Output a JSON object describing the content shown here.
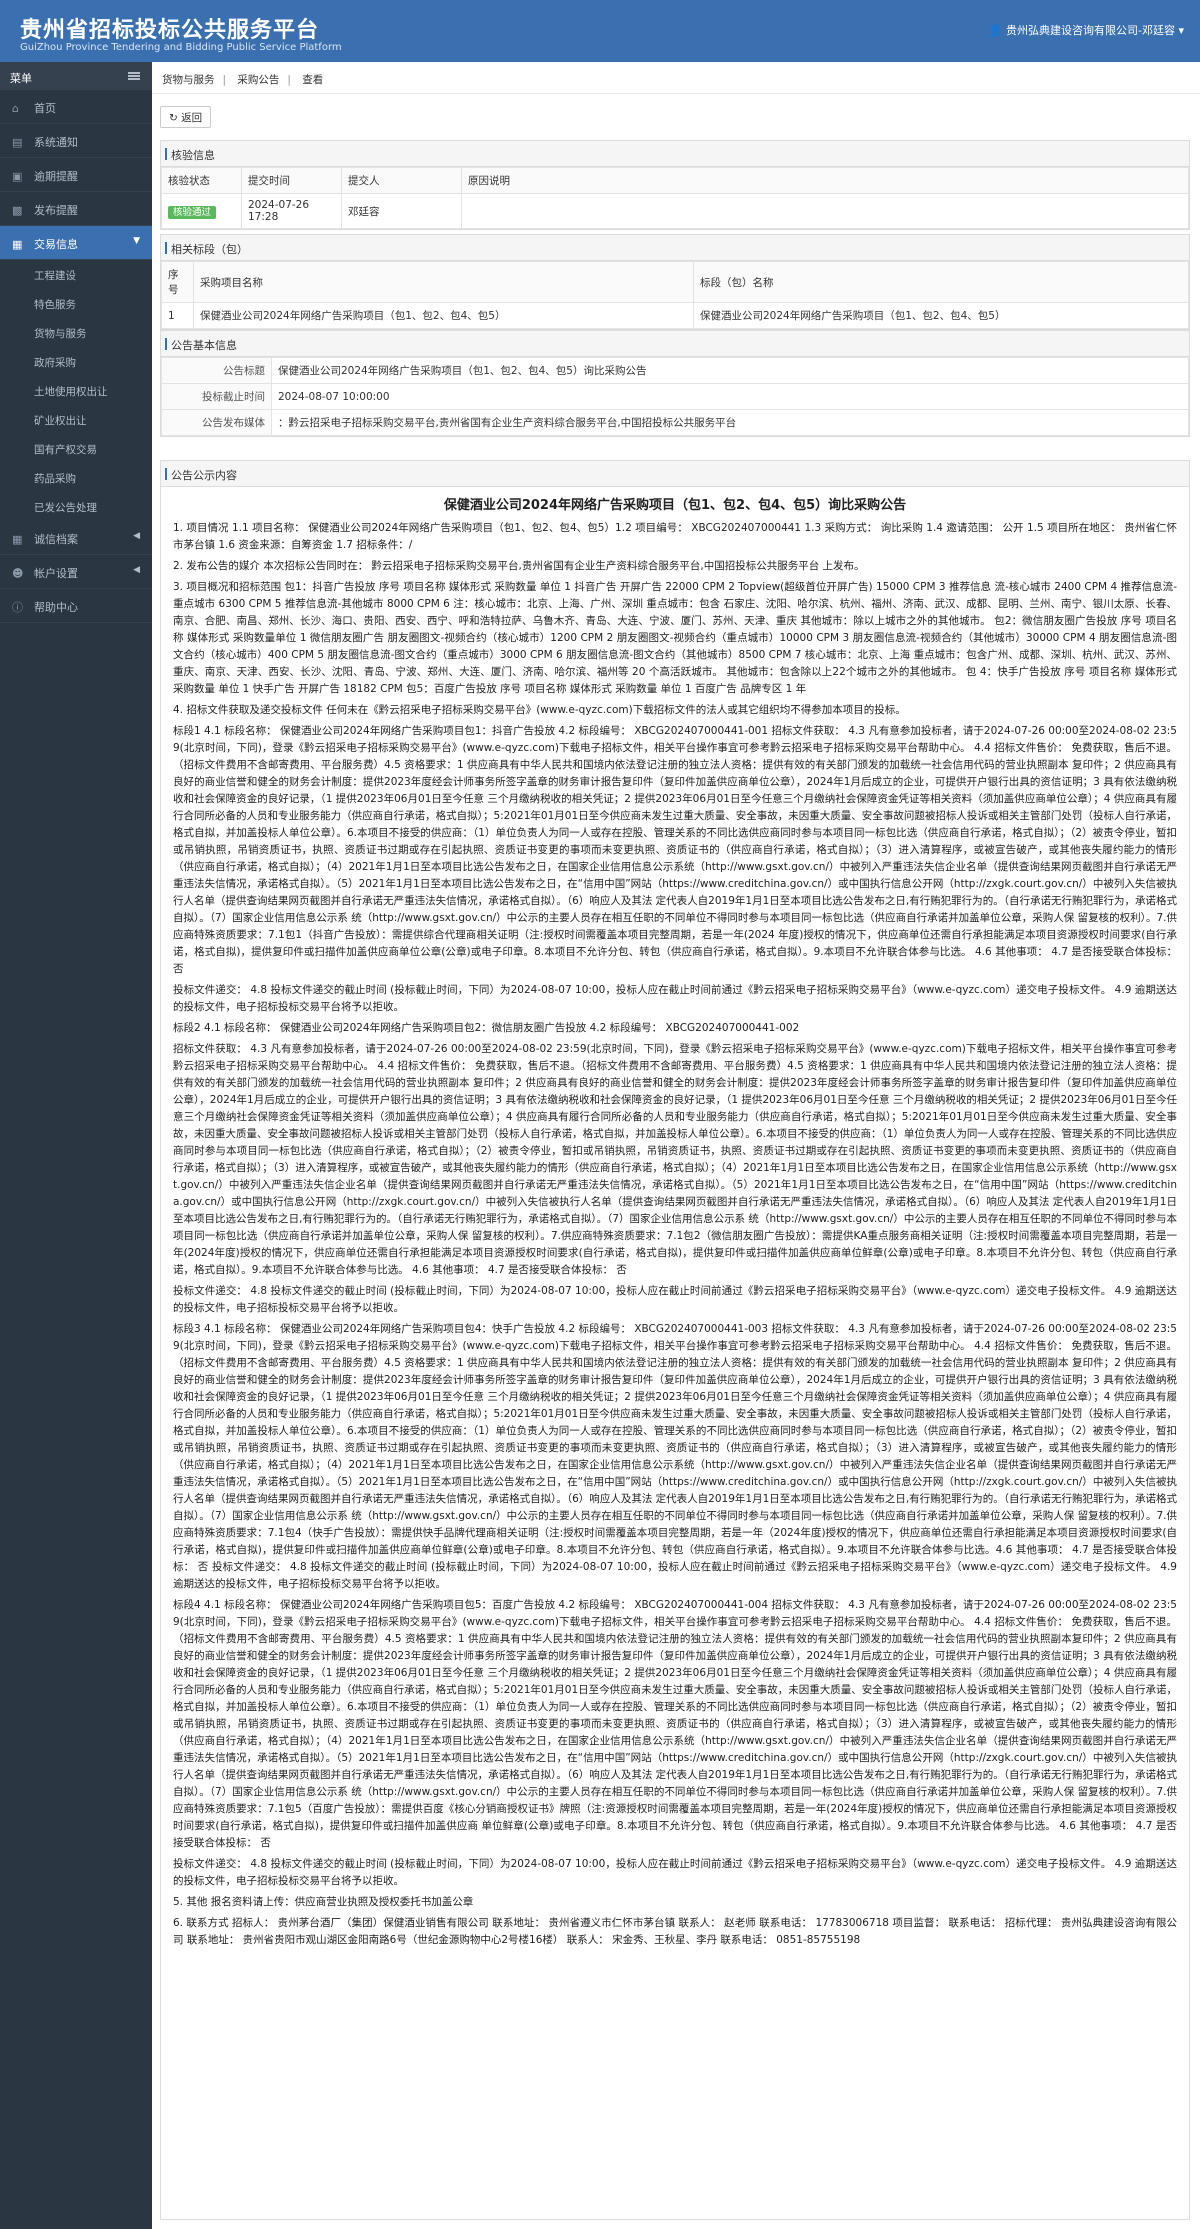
{
  "header": {
    "title_cn": "贵州省招标投标公共服务平台",
    "title_en": "GuiZhou Province Tendering and Bidding Public Service Platform",
    "user": "贵州弘典建设咨询有限公司-邓廷容"
  },
  "sidebar": {
    "menu_label": "菜单",
    "items": [
      {
        "label": "首页",
        "icon": "home-icon"
      },
      {
        "label": "系统通知",
        "icon": "notice-icon"
      },
      {
        "label": "逾期提醒",
        "icon": "alarm-icon"
      },
      {
        "label": "发布提醒",
        "icon": "publish-icon"
      },
      {
        "label": "交易信息",
        "icon": "trade-icon"
      }
    ],
    "sub_items": [
      "工程建设",
      "特色服务",
      "货物与服务",
      "政府采购",
      "土地使用权出让",
      "矿业权出让",
      "国有产权交易",
      "药品采购",
      "已发公告处理"
    ],
    "bottom_items": [
      {
        "label": "诚信档案",
        "icon": "archive-icon"
      },
      {
        "label": "帐户设置",
        "icon": "user-icon"
      },
      {
        "label": "帮助中心",
        "icon": "help-icon"
      }
    ]
  },
  "breadcrumb": [
    "货物与服务",
    "采购公告",
    "查看"
  ],
  "back_label": "返回",
  "review": {
    "title": "核验信息",
    "headers": [
      "核验状态",
      "提交时间",
      "提交人",
      "原因说明"
    ],
    "status": "核验通过",
    "time": "2024-07-26 17:28",
    "person": "邓廷容",
    "reason": ""
  },
  "sections": {
    "title": "相关标段（包）",
    "headers": [
      "序号",
      "采购项目名称",
      "标段（包）名称"
    ],
    "rows": [
      {
        "no": "1",
        "project": "保健酒业公司2024年网络广告采购项目（包1、包2、包4、包5）",
        "section": "保健酒业公司2024年网络广告采购项目（包1、包2、包4、包5）"
      }
    ]
  },
  "basic": {
    "title": "公告基本信息",
    "title_label": "公告标题",
    "title_value": "保健酒业公司2024年网络广告采购项目（包1、包2、包4、包5）询比采购公告",
    "deadline_label": "投标截止时间",
    "deadline_value": "2024-08-07 10:00:00",
    "media_label": "公告发布媒体",
    "media_value": "：黔云招采电子招标采购交易平台,贵州省国有企业生产资料综合服务平台,中国招投标公共服务平台"
  },
  "notice": {
    "panel_title": "公告公示内容",
    "title": "保健酒业公司2024年网络广告采购项目（包1、包2、包4、包5）询比采购公告",
    "paragraphs": [
      "1. 项目情况 1.1 项目名称： 保健酒业公司2024年网络广告采购项目（包1、包2、包4、包5）1.2 项目编号： XBCG202407000441 1.3 采购方式： 询比采购 1.4 邀请范围： 公开 1.5 项目所在地区： 贵州省仁怀市茅台镇 1.6 资金来源：自筹资金 1.7 招标条件：/",
      "2. 发布公告的媒介 本次招标公告同时在： 黔云招采电子招标采购交易平台,贵州省国有企业生产资料综合服务平台,中国招投标公共服务平台 上发布。",
      "3. 项目概况和招标范围 包1：抖音广告投放 序号 项目名称 媒体形式 采购数量 单位 1 抖音广告 开屏广告 22000 CPM 2 Topview(超级首位开屏广告) 15000 CPM 3 推荐信息 流-核心城市 2400 CPM 4 推荐信息流-重点城市 6300 CPM 5 推荐信息流-其他城市 8000 CPM 6 注：核心城市：北京、上海、广州、深圳 重点城市：包含 石家庄、沈阳、哈尔滨、杭州、福州、济南、武汉、成都、昆明、兰州、南宁、银川太原、长春、南京、合肥、南昌、郑州、长沙、海口、贵阳、西安、西宁、呼和浩特拉萨、乌鲁木齐、青岛、大连、宁波、厦门、苏州、天津、重庆 其他城市：除以上城市之外的其他城市。 包2：微信朋友圈广告投放 序号 项目名称 媒体形式 采购数量单位 1 微信朋友圈广告 朋友圈图文-视频合约（核心城市）1200 CPM 2 朋友圈图文-视频合约（重点城市）10000 CPM 3 朋友圈信息流-视频合约（其他城市）30000 CPM 4 朋友圈信息流-图文合约（核心城市）400 CPM 5 朋友圈信息流-图文合约（重点城市）3000 CPM 6 朋友圈信息流-图文合约（其他城市）8500 CPM 7 核心城市：北京、上海 重点城市：包含广州、成都、深圳、杭州、武汉、苏州、重庆、南京、天津、西安、长沙、沈阳、青岛、宁波、郑州、大连、厦门、济南、哈尔滨、福州等 20 个高活跃城市。 其他城市：包含除以上22个城市之外的其他城市。 包 4：快手广告投放 序号 项目名称 媒体形式 采购数量 单位 1 快手广告 开屏广告 18182 CPM 包5：百度广告投放 序号 项目名称 媒体形式 采购数量 单位 1 百度广告 品牌专区 1 年",
      "4. 招标文件获取及递交投标文件 任何未在《黔云招采电子招标采购交易平台》(www.e-qyzc.com)下载招标文件的法人或其它组织均不得参加本项目的投标。",
      "标段1 4.1 标段名称： 保健酒业公司2024年网络广告采购项目包1：抖音广告投放 4.2 标段编号： XBCG202407000441-001 招标文件获取： 4.3 凡有意参加投标者，请于2024-07-26 00:00至2024-08-02 23:59(北京时间，下同)，登录《黔云招采电子招标采购交易平台》(www.e-qyzc.com)下载电子招标文件，相关平台操作事宜可参考黔云招采电子招标采购交易平台帮助中心。 4.4 招标文件售价： 免费获取，售后不退。（招标文件费用不含邮寄费用、平台服务费）4.5 资格要求：1 供应商具有中华人民共和国境内依法登记注册的独立法人资格：提供有效的有关部门颁发的加载统一社会信用代码的营业执照副本 复印件；2 供应商具有良好的商业信誉和健全的财务会计制度：提供2023年度经会计师事务所签字盖章的财务审计报告复印件（复印件加盖供应商单位公章），2024年1月后成立的企业，可提供开户银行出具的资信证明；3 具有依法缴纳税收和社会保障资金的良好记录，（1 提供2023年06月01日至今任意 三个月缴纳税收的相关凭证；2 提供2023年06月01日至今任意三个月缴纳社会保障资金凭证等相关资料（须加盖供应商单位公章）；4 供应商具有履行合同所必备的人员和专业服务能力（供应商自行承诺，格式自拟）；5:2021年01月01日至今供应商未发生过重大质量、安全事故，未因重大质量、安全事故问题被招标人投诉或相关主管部门处罚（投标人自行承诺，格式自拟，并加盖投标人单位公章）。6.本项目不接受的供应商：（1）单位负责人为同一人或存在控股、管理关系的不同比选供应商同时参与本项目同一标包比选（供应商自行承诺，格式自拟）；（2）被责令停业，暂扣或吊销执照，吊销资质证书，执照、资质证书过期或存在引起执照、资质证书变更的事项而未变更执照、资质证书的（供应商自行承诺，格式自拟）；（3）进入清算程序，或被宣告破产，或其他丧失履约能力的情形（供应商自行承诺，格式自拟）；（4）2021年1月1日至本项目比选公告发布之日，在国家企业信用信息公示系统（http://www.gsxt.gov.cn/）中被列入严重违法失信企业名单（提供查询结果网页截图并自行承诺无严重违法失信情况，承诺格式自拟）。（5）2021年1月1日至本项目比选公告发布之日，在“信用中国”网站（https://www.creditchina.gov.cn/）或中国执行信息公开网（http://zxgk.court.gov.cn/）中被列入失信被执行人名单（提供查询结果网页截图并自行承诺无严重违法失信情况，承诺格式自拟）。（6）响应人及其法 定代表人自2019年1月1日至本项目比选公告发布之日,有行贿犯罪行为的。（自行承诺无行贿犯罪行为，承诺格式自拟）。（7）国家企业信用信息公示系 统（http://www.gsxt.gov.cn/）中公示的主要人员存在相互任职的不同单位不得同时参与本项目同一标包比选（供应商自行承诺并加盖单位公章，采购人保 留复核的权利）。7.供应商特殊资质要求：7.1包1（抖音广告投放）：需提供综合代理商相关证明（注:授权时间需覆盖本项目完整周期，若是一年(2024 年度)授权的情况下，供应商单位还需自行承担能满足本项目资源授权时间要求(自行承诺，格式自拟)，提供复印件或扫描件加盖供应商单位公章(公章)或电子印章。8.本项目不允许分包、转包（供应商自行承诺，格式自拟）。9.本项目不允许联合体参与比选。 4.6 其他事项： 4.7 是否接受联合体投标： 否",
      "投标文件递交： 4.8 投标文件递交的截止时间 (投标截止时间，下同）为2024-08-07 10:00，投标人应在截止时间前通过《黔云招采电子招标采购交易平台》（www.e-qyzc.com）递交电子投标文件。 4.9 逾期送达的投标文件，电子招标投标交易平台将予以拒收。",
      "标段2 4.1 标段名称： 保健酒业公司2024年网络广告采购项目包2：微信朋友圈广告投放 4.2 标段编号： XBCG202407000441-002",
      "招标文件获取： 4.3 凡有意参加投标者，请于2024-07-26 00:00至2024-08-02 23:59(北京时间，下同)，登录《黔云招采电子招标采购交易平台》(www.e-qyzc.com)下载电子招标文件，相关平台操作事宜可参考黔云招采电子招标采购交易平台帮助中心。 4.4 招标文件售价： 免费获取，售后不退。（招标文件费用不含邮寄费用、平台服务费）4.5 资格要求：1 供应商具有中华人民共和国境内依法登记注册的独立法人资格：提供有效的有关部门颁发的加载统一社会信用代码的营业执照副本 复印件；2 供应商具有良好的商业信誉和健全的财务会计制度：提供2023年度经会计师事务所签字盖章的财务审计报告复印件（复印件加盖供应商单位公章），2024年1月后成立的企业，可提供开户银行出具的资信证明；3 具有依法缴纳税收和社会保障资金的良好记录，（1 提供2023年06月01日至今任意 三个月缴纳税收的相关凭证；2 提供2023年06月01日至今任意三个月缴纳社会保障资金凭证等相关资料（须加盖供应商单位公章）；4 供应商具有履行合同所必备的人员和专业服务能力（供应商自行承诺，格式自拟）；5:2021年01月01日至今供应商未发生过重大质量、安全事故，未因重大质量、安全事故问题被招标人投诉或相关主管部门处罚（投标人自行承诺，格式自拟，并加盖投标人单位公章）。6.本项目不接受的供应商：（1）单位负责人为同一人或存在控股、管理关系的不同比选供应商同时参与本项目同一标包比选（供应商自行承诺，格式自拟）；（2）被责令停业，暂扣或吊销执照，吊销资质证书，执照、资质证书过期或存在引起执照、资质证书变更的事项而未变更执照、资质证书的（供应商自行承诺，格式自拟）；（3）进入清算程序，或被宣告破产，或其他丧失履约能力的情形（供应商自行承诺，格式自拟）；（4）2021年1月1日至本项目比选公告发布之日，在国家企业信用信息公示系统（http://www.gsxt.gov.cn/）中被列入严重违法失信企业名单（提供查询结果网页截图并自行承诺无严重违法失信情况，承诺格式自拟）。（5）2021年1月1日至本项目比选公告发布之日，在“信用中国”网站（https://www.creditchina.gov.cn/）或中国执行信息公开网（http://zxgk.court.gov.cn/）中被列入失信被执行人名单（提供查询结果网页截图并自行承诺无严重违法失信情况，承诺格式自拟）。（6）响应人及其法 定代表人自2019年1月1日至本项目比选公告发布之日,有行贿犯罪行为的。（自行承诺无行贿犯罪行为，承诺格式自拟）。（7）国家企业信用信息公示系 统（http://www.gsxt.gov.cn/）中公示的主要人员存在相互任职的不同单位不得同时参与本项目同一标包比选（供应商自行承诺并加盖单位公章，采购人保 留复核的权利）。7.供应商特殊资质要求：7.1包2（微信朋友圈广告投放）：需提供KA重点服务商相关证明（注:授权时间需覆盖本项目完整周期，若是一年(2024年度)授权的情况下，供应商单位还需自行承担能满足本项目资源授权时间要求(自行承诺，格式自拟)，提供复印件或扫描件加盖供应商单位鲜章(公章)或电子印章。8.本项目不允许分包、转包（供应商自行承诺，格式自拟）。9.本项目不允许联合体参与比选。 4.6 其他事项： 4.7 是否接受联合体投标： 否",
      "投标文件递交： 4.8 投标文件递交的截止时间 (投标截止时间，下同）为2024-08-07 10:00，投标人应在截止时间前通过《黔云招采电子招标采购交易平台》（www.e-qyzc.com）递交电子投标文件。 4.9 逾期送达的投标文件，电子招标投标交易平台将予以拒收。",
      "标段3 4.1 标段名称： 保健酒业公司2024年网络广告采购项目包4：快手广告投放 4.2 标段编号： XBCG202407000441-003 招标文件获取： 4.3 凡有意参加投标者，请于2024-07-26 00:00至2024-08-02 23:59(北京时间，下同)，登录《黔云招采电子招标采购交易平台》(www.e-qyzc.com)下载电子招标文件，相关平台操作事宜可参考黔云招采电子招标采购交易平台帮助中心。 4.4 招标文件售价： 免费获取，售后不退。（招标文件费用不含邮寄费用、平台服务费）4.5 资格要求：1 供应商具有中华人民共和国境内依法登记注册的独立法人资格：提供有效的有关部门颁发的加载统一社会信用代码的营业执照副本 复印件；2 供应商具有良好的商业信誉和健全的财务会计制度：提供2023年度经会计师事务所签字盖章的财务审计报告复印件（复印件加盖供应商单位公章），2024年1月后成立的企业，可提供开户银行出具的资信证明；3 具有依法缴纳税收和社会保障资金的良好记录，（1 提供2023年06月01日至今任意 三个月缴纳税收的相关凭证；2 提供2023年06月01日至今任意三个月缴纳社会保障资金凭证等相关资料（须加盖供应商单位公章）；4 供应商具有履行合同所必备的人员和专业服务能力（供应商自行承诺，格式自拟）；5:2021年01月01日至今供应商未发生过重大质量、安全事故，未因重大质量、安全事故问题被招标人投诉或相关主管部门处罚（投标人自行承诺，格式自拟，并加盖投标人单位公章）。6.本项目不接受的供应商：（1）单位负责人为同一人或存在控股、管理关系的不同比选供应商同时参与本项目同一标包比选（供应商自行承诺，格式自拟）；（2）被责令停业，暂扣或吊销执照，吊销资质证书，执照、资质证书过期或存在引起执照、资质证书变更的事项而未变更执照、资质证书的（供应商自行承诺，格式自拟）；（3）进入清算程序，或被宣告破产，或其他丧失履约能力的情形（供应商自行承诺，格式自拟）；（4）2021年1月1日至本项目比选公告发布之日，在国家企业信用信息公示系统（http://www.gsxt.gov.cn/）中被列入严重违法失信企业名单（提供查询结果网页截图并自行承诺无严重违法失信情况，承诺格式自拟）。（5）2021年1月1日至本项目比选公告发布之日，在“信用中国”网站（https://www.creditchina.gov.cn/）或中国执行信息公开网（http://zxgk.court.gov.cn/）中被列入失信被执行人名单（提供查询结果网页截图并自行承诺无严重违法失信情况，承诺格式自拟）。（6）响应人及其法 定代表人自2019年1月1日至本项目比选公告发布之日,有行贿犯罪行为的。（自行承诺无行贿犯罪行为，承诺格式自拟）。（7）国家企业信用信息公示系 统（http://www.gsxt.gov.cn/）中公示的主要人员存在相互任职的不同单位不得同时参与本项目同一标包比选（供应商自行承诺并加盖单位公章，采购人保 留复核的权利）。7.供应商特殊资质要求：7.1包4（快手广告投放）：需提供快手品牌代理商相关证明（注:授权时间需覆盖本项目完整周期，若是一年（2024年度)授权的情况下，供应商单位还需自行承担能满足本项目资源授权时间要求(自行承诺，格式自拟)，提供复印件或扫描件加盖供应商单位鲜章(公章)或电子印章。8.本项目不允许分包、转包（供应商自行承诺，格式自拟）。9.本项目不允许联合体参与比选。4.6 其他事项： 4.7 是否接受联合体投标： 否 投标文件递交： 4.8 投标文件递交的截止时间 (投标截止时间，下同）为2024-08-07 10:00，投标人应在截止时间前通过《黔云招采电子招标采购交易平台》（www.e-qyzc.com）递交电子投标文件。 4.9 逾期送达的投标文件，电子招标投标交易平台将予以拒收。",
      "标段4 4.1 标段名称： 保健酒业公司2024年网络广告采购项目包5：百度广告投放 4.2 标段编号： XBCG202407000441-004 招标文件获取： 4.3 凡有意参加投标者，请于2024-07-26 00:00至2024-08-02 23:59(北京时间，下同)，登录《黔云招采电子招标采购交易平台》(www.e-qyzc.com)下载电子招标文件，相关平台操作事宜可参考黔云招采电子招标采购交易平台帮助中心。 4.4 招标文件售价： 免费获取，售后不退。（招标文件费用不含邮寄费用、平台服务费）4.5 资格要求：1 供应商具有中华人民共和国境内依法登记注册的独立法人资格：提供有效的有关部门颁发的加载统一社会信用代码的营业执照副本复印件；2 供应商具有良好的商业信誉和健全的财务会计制度：提供2023年度经会计师事务所签字盖章的财务审计报告复印件（复印件加盖供应商单位公章），2024年1月后成立的企业，可提供开户银行出具的资信证明；3 具有依法缴纳税收和社会保障资金的良好记录，（1 提供2023年06月01日至今任意 三个月缴纳税收的相关凭证；2 提供2023年06月01日至今任意三个月缴纳社会保障资金凭证等相关资料（须加盖供应商单位公章）；4 供应商具有履行合同所必备的人员和专业服务能力（供应商自行承诺，格式自拟）；5:2021年01月01日至今供应商未发生过重大质量、安全事故，未因重大质量、安全事故问题被招标人投诉或相关主管部门处罚（投标人自行承诺，格式自拟，并加盖投标人单位公章）。6.本项目不接受的供应商：（1）单位负责人为同一人或存在控股、管理关系的不同比选供应商同时参与本项目同一标包比选（供应商自行承诺，格式自拟）；（2）被责令停业，暂扣或吊销执照，吊销资质证书，执照、资质证书过期或存在引起执照、资质证书变更的事项而未变更执照、资质证书的（供应商自行承诺，格式自拟）；（3）进入清算程序，或被宣告破产，或其他丧失履约能力的情形（供应商自行承诺，格式自拟）；（4）2021年1月1日至本项目比选公告发布之日，在国家企业信用信息公示系统（http://www.gsxt.gov.cn/）中被列入严重违法失信企业名单（提供查询结果网页截图并自行承诺无严重违法失信情况，承诺格式自拟）。（5）2021年1月1日至本项目比选公告发布之日，在“信用中国”网站（https://www.creditchina.gov.cn/）或中国执行信息公开网（http://zxgk.court.gov.cn/）中被列入失信被执行人名单（提供查询结果网页截图并自行承诺无严重违法失信情况，承诺格式自拟）。（6）响应人及其法 定代表人自2019年1月1日至本项目比选公告发布之日,有行贿犯罪行为的。（自行承诺无行贿犯罪行为，承诺格式自拟）。（7）国家企业信用信息公示系 统（http://www.gsxt.gov.cn/）中公示的主要人员存在相互任职的不同单位不得同时参与本项目同一标包比选（供应商自行承诺并加盖单位公章，采购人保 留复核的权利）。7.供应商特殊资质要求：7.1包5（百度广告投放）：需提供百度《核心分销商授权证书》牌照（注:资源授权时间需覆盖本项目完整周期，若是一年(2024年度)授权的情况下，供应商单位还需自行承担能满足本项目资源授权时间要求(自行承诺，格式自拟)，提供复印件或扫描件加盖供应商 单位鲜章(公章)或电子印章。8.本项目不允许分包、转包（供应商自行承诺，格式自拟）。9.本项目不允许联合体参与比选。 4.6 其他事项： 4.7 是否接受联合体投标： 否",
      "投标文件递交： 4.8 投标文件递交的截止时间 (投标截止时间，下同）为2024-08-07 10:00，投标人应在截止时间前通过《黔云招采电子招标采购交易平台》（www.e-qyzc.com）递交电子投标文件。 4.9 逾期送达的投标文件，电子招标投标交易平台将予以拒收。",
      "5. 其他 报名资料请上传：供应商营业执照及授权委托书加盖公章",
      "6. 联系方式 招标人： 贵州茅台酒厂（集团）保健酒业销售有限公司 联系地址： 贵州省遵义市仁怀市茅台镇 联系人： 赵老师 联系电话： 17783006718 项目监督： 联系电话： 招标代理： 贵州弘典建设咨询有限公司 联系地址： 贵州省贵阳市观山湖区金阳南路6号（世纪金源购物中心2号楼16楼） 联系人： 宋金秀、王秋星、李丹 联系电话： 0851-85755198"
    ]
  }
}
